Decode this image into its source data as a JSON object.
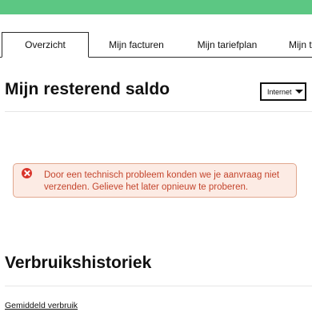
{
  "header": {
    "accent_color": "#5cc783"
  },
  "tabs": [
    {
      "label": "Overzicht",
      "active": true
    },
    {
      "label": "Mijn facturen",
      "active": false
    },
    {
      "label": "Mijn tariefplan",
      "active": false
    },
    {
      "label": "Mijn t",
      "active": false
    }
  ],
  "saldo": {
    "title": "Mijn resterend saldo",
    "dropdown": {
      "selected": "Internet",
      "icon": "chevron-down-icon"
    }
  },
  "alert": {
    "icon": "error-x-icon",
    "message": "Door een technisch probleem konden we je aanvraag niet verzenden. Gelieve het later opnieuw te proberen.",
    "text_color": "#c4452d",
    "background_color": "#fcebe4",
    "border_color": "#e1a78e"
  },
  "history": {
    "title": "Verbruikshistoriek",
    "link_label": "Gemiddeld verbruik"
  }
}
